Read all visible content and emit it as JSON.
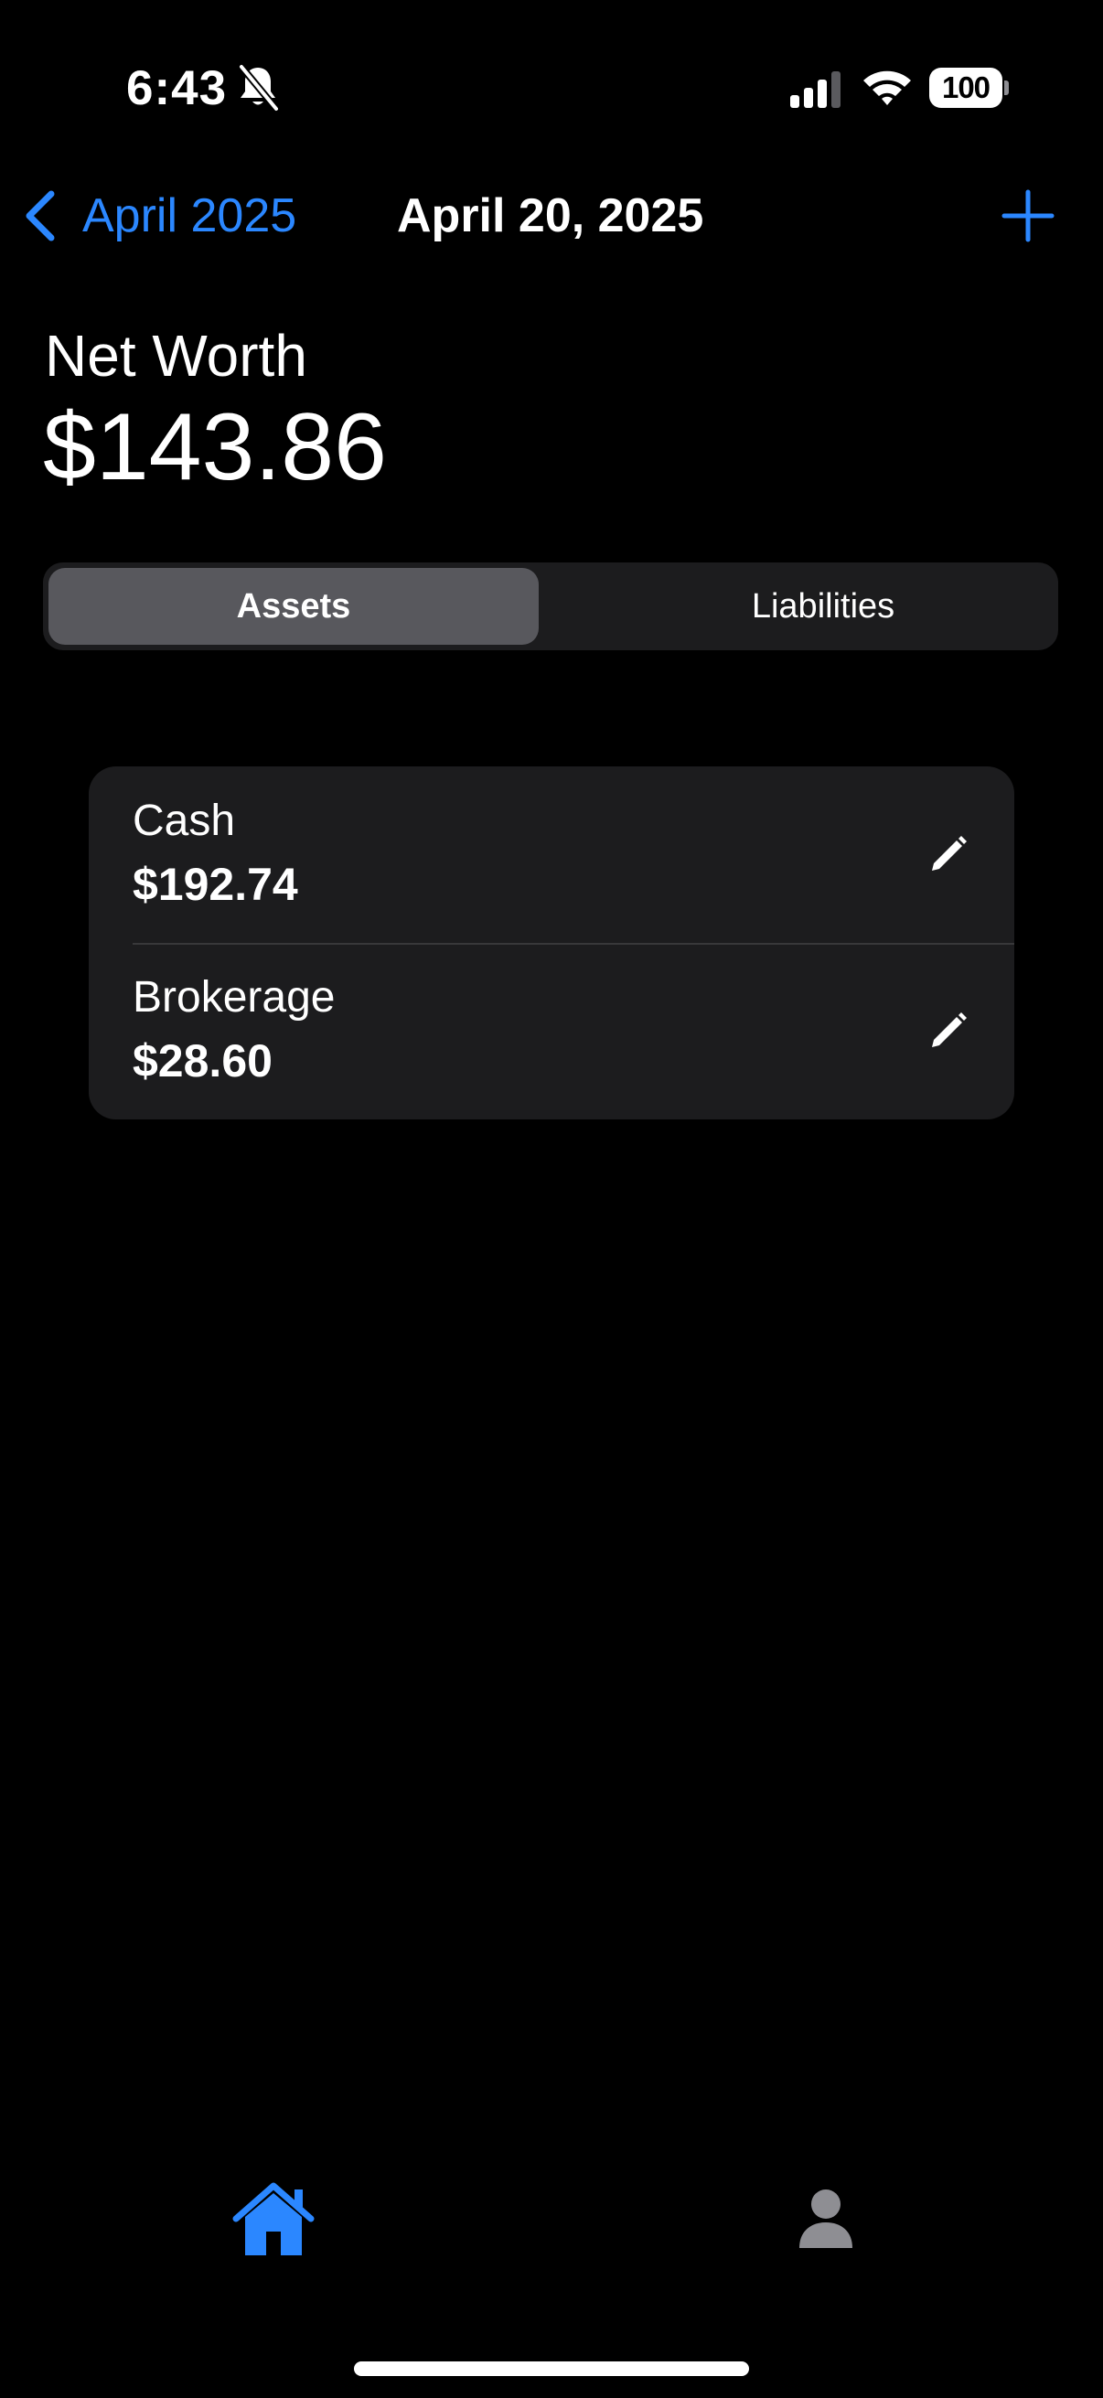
{
  "status_bar": {
    "time": "6:43",
    "battery_level": "100",
    "icons": [
      "bell-slash-icon",
      "cellular-signal-icon",
      "wifi-icon",
      "battery-icon"
    ]
  },
  "nav": {
    "back_label": "April 2025",
    "title": "April 20, 2025",
    "back_icon": "chevron-left-icon",
    "add_icon": "plus-icon"
  },
  "net_worth": {
    "label": "Net Worth",
    "value": "$143.86"
  },
  "segments": {
    "selected": "Assets",
    "items": [
      {
        "label": "Assets"
      },
      {
        "label": "Liabilities"
      }
    ]
  },
  "accounts": [
    {
      "name": "Cash",
      "value": "$192.74",
      "icon": "pencil-icon"
    },
    {
      "name": "Brokerage",
      "value": "$28.60",
      "icon": "pencil-icon"
    }
  ],
  "tab_bar": {
    "items": [
      {
        "icon": "house-icon",
        "active": true
      },
      {
        "icon": "person-icon",
        "active": false
      }
    ]
  },
  "colors": {
    "accent": "#2b87ff",
    "background": "#000000",
    "card": "#1c1c1e",
    "segment_selected": "#58585d",
    "inactive_icon": "#8e8e93"
  }
}
